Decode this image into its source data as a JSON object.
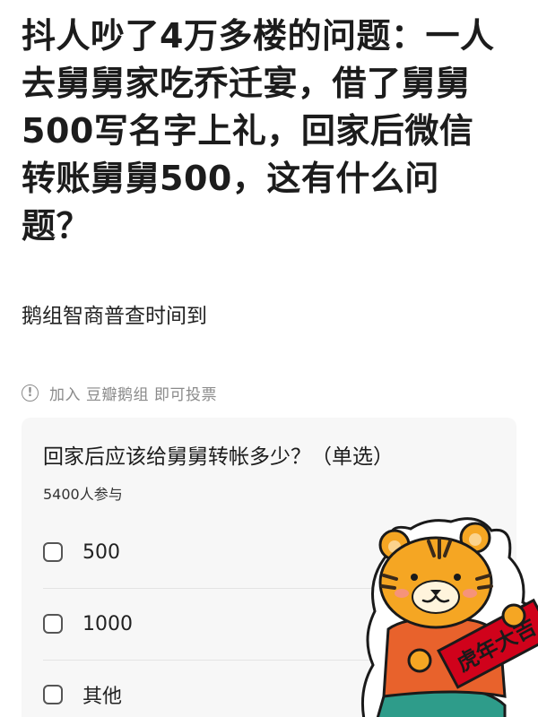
{
  "post": {
    "title": "抖人吵了4万多楼的问题：一人去舅舅家吃乔迁宴，借了舅舅500写名字上礼，回家后微信转账舅舅500，这有什么问题？",
    "subtitle": "鹅组智商普查时间到"
  },
  "notice": {
    "icon": "info-icon",
    "join_label": "加入",
    "group_name": "豆瓣鹅组",
    "suffix": "即可投票"
  },
  "poll": {
    "question": "回家后应该给舅舅转帐多少？（单选）",
    "participants": "5400人参与",
    "options": [
      {
        "label": "500"
      },
      {
        "label": "1000"
      },
      {
        "label": "其他"
      }
    ]
  },
  "sticker": {
    "icon": "tiger-new-year-sticker",
    "banner_text": "虎年大吉",
    "colors": {
      "tiger": "#f5a623",
      "stripes": "#3a2a1a",
      "banner": "#d0021b",
      "shirt": "#e8622c",
      "pants": "#2e9c8a"
    }
  }
}
